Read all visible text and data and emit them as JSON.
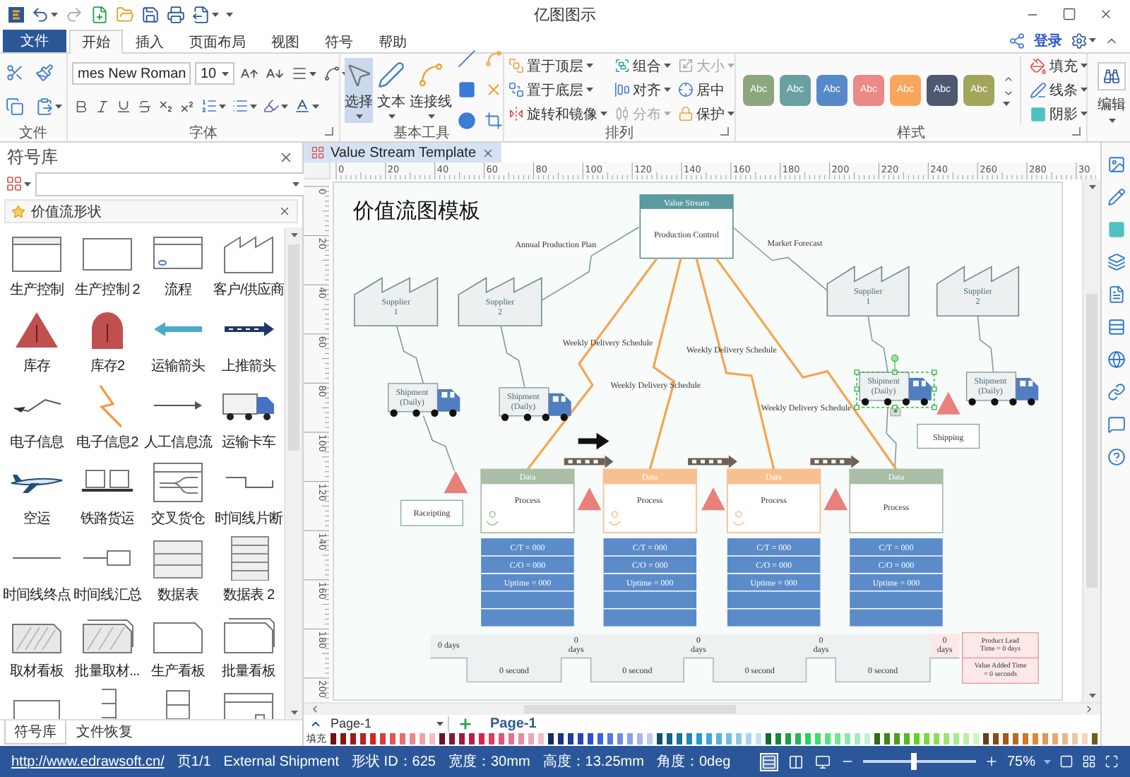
{
  "title_bar": {
    "title": "亿图图示"
  },
  "menu_tabs": [
    {
      "label": "文件",
      "kind": "file",
      "selected": false
    },
    {
      "label": "开始",
      "kind": "tab",
      "selected": true
    },
    {
      "label": "插入",
      "kind": "tab",
      "selected": false
    },
    {
      "label": "页面布局",
      "kind": "tab",
      "selected": false
    },
    {
      "label": "视图",
      "kind": "tab",
      "selected": false
    },
    {
      "label": "符号",
      "kind": "tab",
      "selected": false
    },
    {
      "label": "帮助",
      "kind": "tab",
      "selected": false
    }
  ],
  "account": {
    "login": "登录"
  },
  "ribbon": {
    "clipboard_group": "文件",
    "font": {
      "name": "mes New Roman",
      "size": "10",
      "group": "字体"
    },
    "tools": {
      "items": [
        {
          "label": "选择",
          "selected": true
        },
        {
          "label": "文本",
          "selected": false
        },
        {
          "label": "连接线",
          "selected": false
        }
      ],
      "group": "基本工具"
    },
    "arrange": {
      "items": [
        {
          "label": "置于顶层",
          "disabled": false,
          "dropdown": true
        },
        {
          "label": "置于底层",
          "disabled": false,
          "dropdown": true
        },
        {
          "label": "旋转和镜像",
          "disabled": false,
          "dropdown": true
        },
        {
          "label": "组合",
          "disabled": false,
          "dropdown": true
        },
        {
          "label": "对齐",
          "disabled": false,
          "dropdown": true
        },
        {
          "label": "分布",
          "disabled": true,
          "dropdown": true
        },
        {
          "label": "大小",
          "disabled": true,
          "dropdown": true
        },
        {
          "label": "居中",
          "disabled": false,
          "dropdown": false
        },
        {
          "label": "保护",
          "disabled": false,
          "dropdown": true
        }
      ],
      "group": "排列"
    },
    "styles": {
      "swatches": [
        {
          "label": "Abc",
          "color": "#8ca67e"
        },
        {
          "label": "Abc",
          "color": "#6aa0a2"
        },
        {
          "label": "Abc",
          "color": "#5689c8"
        },
        {
          "label": "Abc",
          "color": "#ea8985"
        },
        {
          "label": "Abc",
          "color": "#f7a65c"
        },
        {
          "label": "Abc",
          "color": "#4e5870"
        },
        {
          "label": "Abc",
          "color": "#a1a65b"
        }
      ],
      "group": "样式"
    },
    "format": [
      {
        "label": "填充"
      },
      {
        "label": "线条"
      },
      {
        "label": "阴影"
      }
    ],
    "edit": "编辑"
  },
  "library": {
    "title": "符号库",
    "category": "价值流形状",
    "shapes": [
      {
        "kind": "control",
        "label": "生产控制"
      },
      {
        "kind": "control2",
        "label": "生产控制 2"
      },
      {
        "kind": "process",
        "label": "流程"
      },
      {
        "kind": "factory",
        "label": "客户/供应商"
      },
      {
        "kind": "triangle",
        "label": "库存"
      },
      {
        "kind": "dome",
        "label": "库存2"
      },
      {
        "kind": "arrow",
        "label": "运输箭头"
      },
      {
        "kind": "push",
        "label": "上推箭头"
      },
      {
        "kind": "bolt",
        "label": "电子信息"
      },
      {
        "kind": "bolt2",
        "label": "电子信息2"
      },
      {
        "kind": "manual",
        "label": "人工信息流"
      },
      {
        "kind": "truck",
        "label": "运输卡车"
      },
      {
        "kind": "plane",
        "label": "空运"
      },
      {
        "kind": "rail",
        "label": "铁路货运"
      },
      {
        "kind": "crossdock",
        "label": "交叉货仓"
      },
      {
        "kind": "timeline",
        "label": "时间线片断"
      },
      {
        "kind": "timeend",
        "label": "时间线终点"
      },
      {
        "kind": "timesum",
        "label": "时间线汇总"
      },
      {
        "kind": "table",
        "label": "数据表"
      },
      {
        "kind": "table2",
        "label": "数据表 2"
      },
      {
        "kind": "kanban",
        "label": "取材看板"
      },
      {
        "kind": "kanbanbatch",
        "label": "批量取材..."
      },
      {
        "kind": "prodkanban",
        "label": "生产看板"
      },
      {
        "kind": "batchkanban",
        "label": "批量看板"
      },
      {
        "kind": "rect"
      },
      {
        "kind": "brackets"
      },
      {
        "kind": "stack"
      },
      {
        "kind": "door"
      }
    ],
    "tabs": [
      {
        "label": "符号库",
        "selected": true
      },
      {
        "label": "文件恢复",
        "selected": false
      }
    ]
  },
  "document_tab": {
    "title": "Value Stream Template"
  },
  "rulers": {
    "horizontal": [
      "0",
      "20",
      "40",
      "60",
      "80",
      "100",
      "120",
      "140",
      "160",
      "180",
      "200",
      "220",
      "240",
      "260",
      "280",
      "30"
    ],
    "vertical": [
      "0",
      "20",
      "40",
      "60",
      "80",
      "100",
      "120",
      "140",
      "160",
      "180",
      "200"
    ]
  },
  "diagram": {
    "title": "价值流图模板",
    "control": {
      "header": "Value Stream",
      "label": "Production Control"
    },
    "info_flows": [
      "Annual Production Plan",
      "Market Forecast"
    ],
    "suppliers": [
      {
        "lines": [
          "Supplier",
          "1"
        ]
      },
      {
        "lines": [
          "Supplier",
          "2"
        ]
      },
      {
        "lines": [
          "Supplier",
          "1"
        ]
      },
      {
        "lines": [
          "Supplier",
          "2"
        ]
      }
    ],
    "trucks": [
      {
        "lines": [
          "Shipment",
          "(Daily)"
        ],
        "selected": false
      },
      {
        "lines": [
          "Shipment",
          "(Daily)"
        ],
        "selected": false
      },
      {
        "lines": [
          "Shipment",
          "(Daily)"
        ],
        "selected": true
      },
      {
        "lines": [
          "Shipment",
          "(Daily)"
        ],
        "selected": false
      }
    ],
    "schedules": [
      "Weekly Delivery Schedule",
      "Weekly Delivery Schedule",
      "Weekly Delivery Schedule",
      "Weekly Delivery Schedule"
    ],
    "shipping": "Shipping",
    "receiving": "Raceipting",
    "processes": [
      {
        "header": "Data",
        "label": "Process",
        "color": "#a9bea5",
        "operator": true,
        "stats": [
          "C/T = 000",
          "C/O = 000",
          "Uptime = 000"
        ]
      },
      {
        "header": "Data",
        "label": "Process",
        "color": "#f9c08f",
        "operator": true,
        "stats": [
          "C/T = 000",
          "C/O = 000",
          "Uptime = 000"
        ]
      },
      {
        "header": "Data",
        "label": "Process",
        "color": "#f9c08f",
        "operator": true,
        "stats": [
          "C/T = 000",
          "C/O = 000",
          "Uptime = 000"
        ]
      },
      {
        "header": "Data",
        "label": "Process",
        "color": "#a9bea5",
        "operator": false,
        "stats": [
          "C/T = 000",
          "C/O = 000",
          "Uptime = 000"
        ]
      }
    ],
    "timeline": {
      "waits": [
        {
          "lines": [
            "0 days"
          ]
        },
        {
          "lines": [
            "0",
            "days"
          ]
        },
        {
          "lines": [
            "0",
            "days"
          ]
        },
        {
          "lines": [
            "0",
            "days"
          ]
        },
        {
          "lines": [
            "0",
            "days"
          ]
        }
      ],
      "processing": [
        "0 second",
        "0 second",
        "0 second",
        "0 second"
      ],
      "totals": [
        {
          "lines": [
            "Product Lead",
            "Time = 0 days"
          ]
        },
        {
          "lines": [
            "Value Added Time",
            "= 0 seconds"
          ]
        }
      ]
    }
  },
  "page_bar": {
    "page_select": "Page-1",
    "pages": [
      {
        "label": "Page-1",
        "selected": true
      }
    ]
  },
  "palette": {
    "label": "填充"
  },
  "status_bar": {
    "link": "http://www.edrawsoft.cn/",
    "items": [
      "页1/1",
      "External Shipment",
      "形状 ID：625",
      "宽度：30mm",
      "高度：13.25mm",
      "角度：0deg"
    ],
    "zoom": {
      "level": 0.45,
      "reading": "75%"
    }
  }
}
